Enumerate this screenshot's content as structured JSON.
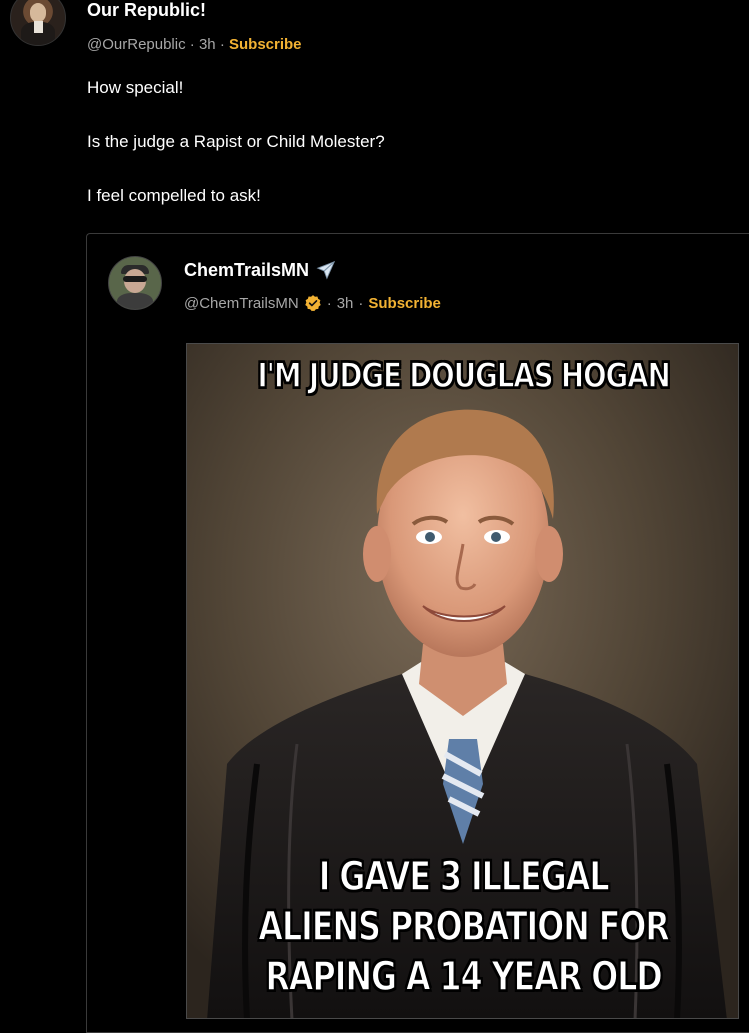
{
  "post": {
    "author_name": "Our Republic!",
    "handle": "@OurRepublic",
    "separator": "·",
    "time": "3h",
    "subscribe_label": "Subscribe",
    "body_lines": [
      "How special!",
      "Is the judge a Rapist or Child Molester?",
      "I feel compelled to ask!"
    ],
    "avatar_icon": "portrait-avatar"
  },
  "quoted_post": {
    "author_name": "ChemTrailsMN",
    "name_icon": "airplane-icon",
    "handle": "@ChemTrailsMN",
    "verified_icon": "verified-badge-icon",
    "separator": "·",
    "time": "3h",
    "subscribe_label": "Subscribe",
    "avatar_icon": "user-avatar",
    "meme": {
      "top_text": "I'M JUDGE DOUGLAS HOGAN",
      "bottom_lines": [
        "I GAVE 3 ILLEGAL",
        "ALIENS PROBATION FOR",
        "RAPING A 14 YEAR OLD"
      ]
    }
  },
  "colors": {
    "background": "#000000",
    "text_primary": "#ffffff",
    "text_secondary": "#a7a7a7",
    "subscribe_accent": "#f2b233",
    "border": "#3a3a3a"
  }
}
